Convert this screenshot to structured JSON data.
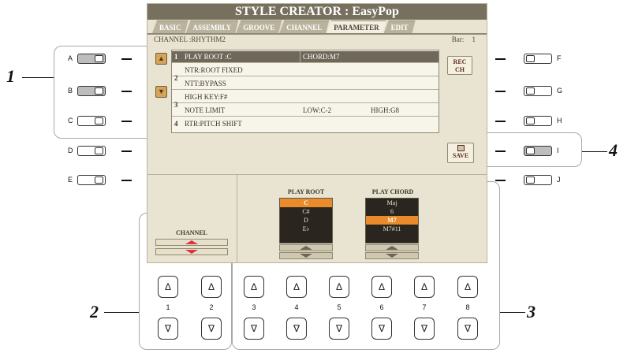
{
  "lcd": {
    "title": "STYLE CREATOR : EasyPop",
    "tabs": [
      "BASIC",
      "ASSEMBLY",
      "GROOVE",
      "CHANNEL",
      "PARAMETER",
      "EDIT"
    ],
    "channel_label": "CHANNEL :RHYTHM2",
    "bar_label": "Bar:",
    "bar_value": "1",
    "scroll_up_icon": "triangle-up-icon",
    "scroll_down_icon": "triangle-down-icon",
    "rows": [
      {
        "num": "1",
        "c1": "PLAY ROOT    :C",
        "c2": "CHORD:M7",
        "c3": ""
      },
      {
        "num": "",
        "c1": "NTR:ROOT FIXED",
        "c2": "",
        "c3": ""
      },
      {
        "num": "",
        "c1": "NTT:BYPASS",
        "c2": "",
        "c3": ""
      },
      {
        "num": "",
        "c1": "HIGH KEY:F#",
        "c2": "",
        "c3": ""
      },
      {
        "num": "",
        "c1": "NOTE LIMIT",
        "c2": "LOW:C-2",
        "c3": "HIGH:G8"
      },
      {
        "num": "4",
        "c1": "RTR:PITCH SHIFT",
        "c2": "",
        "c3": ""
      }
    ],
    "side_nums": {
      "two": "2",
      "three": "3"
    },
    "rec_ch": {
      "line1": "REC",
      "line2": "CH"
    },
    "save": "SAVE"
  },
  "lower": {
    "channel_head": "CHANNEL",
    "play_root_head": "PLAY ROOT",
    "play_chord_head": "PLAY CHORD",
    "play_root_options": [
      "C",
      "C#",
      "D",
      "E♭"
    ],
    "play_root_selected": 0,
    "play_chord_options": [
      "Maj",
      "6",
      "M7",
      "M7#11"
    ],
    "play_chord_selected": 2
  },
  "side_buttons": {
    "left": [
      "A",
      "B",
      "C",
      "D",
      "E"
    ],
    "right": [
      "F",
      "G",
      "H",
      "I",
      "J"
    ]
  },
  "bottom_buttons": [
    "1",
    "2",
    "3",
    "4",
    "5",
    "6",
    "7",
    "8"
  ],
  "callouts": {
    "c1": "1",
    "c2": "2",
    "c3": "3",
    "c4": "4"
  },
  "colors": {
    "lcd_bg": "#e9e4d2",
    "title_bg": "#77705f",
    "selected_row": "#6f685a",
    "picker_highlight": "#e98b2b",
    "red_arrow": "#e0323a"
  }
}
